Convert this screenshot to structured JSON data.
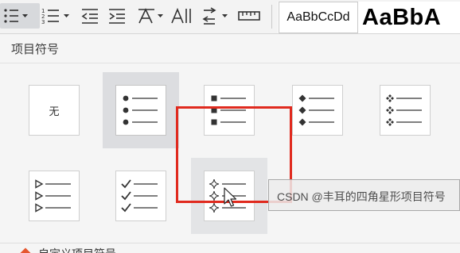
{
  "toolbar": {
    "items": [
      {
        "name": "bullet-list",
        "icon": "bullet-list-icon",
        "active": true
      },
      {
        "name": "numbered-list",
        "icon": "numbered-list-icon"
      },
      {
        "name": "decrease-indent",
        "icon": "outdent-icon"
      },
      {
        "name": "increase-indent",
        "icon": "indent-icon"
      },
      {
        "name": "chinese-layout",
        "icon": "sort-icon"
      },
      {
        "name": "text-direction",
        "icon": "text-direction-icon"
      },
      {
        "name": "line-spacing",
        "icon": "line-spacing-icon"
      },
      {
        "name": "ruler",
        "icon": "ruler-icon"
      }
    ],
    "styles": [
      {
        "label": "AaBbCcDd"
      },
      {
        "label": "AaBbA"
      }
    ]
  },
  "bullet_menu": {
    "title": "项目符号",
    "options": [
      {
        "id": "none",
        "label": "无"
      },
      {
        "id": "filled-circle",
        "state": "selected"
      },
      {
        "id": "filled-square"
      },
      {
        "id": "filled-diamond"
      },
      {
        "id": "four-diamond-cluster"
      },
      {
        "id": "arrowhead"
      },
      {
        "id": "checkmark"
      },
      {
        "id": "hollow-star",
        "state": "hovered"
      }
    ],
    "tooltip": "CSDN @丰耳的四角星形项目符号",
    "more_label": "自定义项目符号"
  },
  "colors": {
    "highlight": "#e02a1e",
    "selected_bg": "#dcdde0",
    "accent": "#e5572f"
  }
}
